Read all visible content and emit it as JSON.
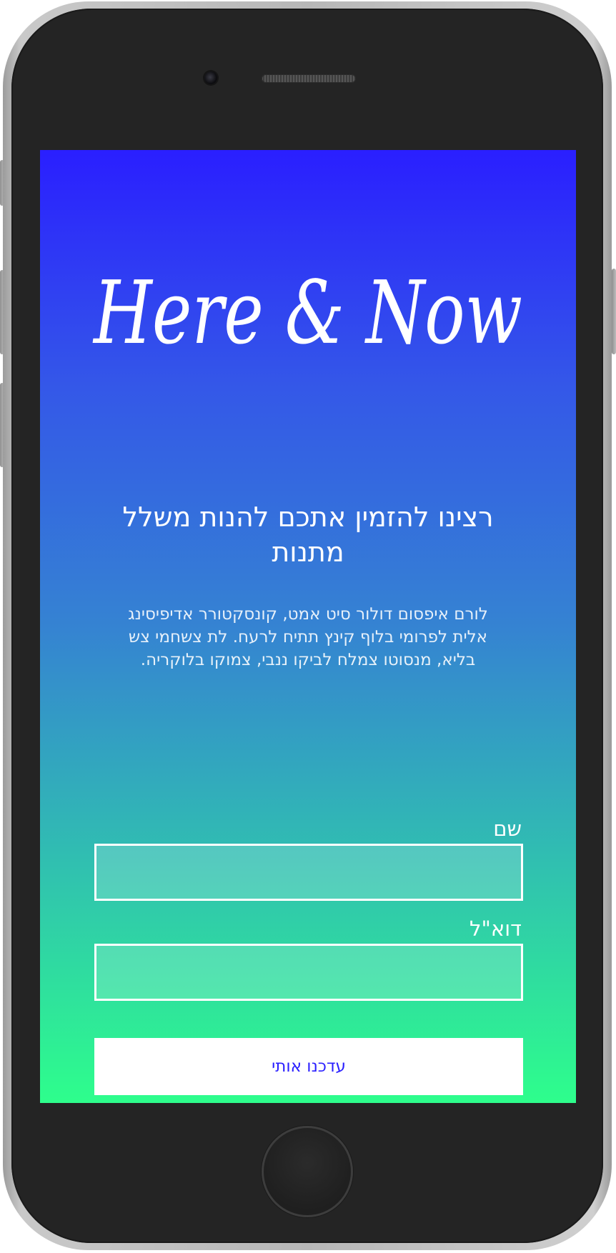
{
  "screen": {
    "background_top": "#2a1fff",
    "background_bottom": "#2efe8c"
  },
  "logo": {
    "text": "Here & Now"
  },
  "headline": {
    "text": "רצינו להזמין אתכם להנות משלל מתנות"
  },
  "body": {
    "text": "לורם איפסום דולור סיט אמט, קונסקטורר אדיפיסינג אלית לפרומי בלוף קינץ תתיח לרעח. לת צשחמי צש בליא, מנסוטו צמלח לביקו ננבי, צמוקו בלוקריה."
  },
  "form": {
    "name_label": "שם",
    "name_value": "",
    "email_label": "דוא\"ל",
    "email_value": "",
    "submit_label": "עדכנו אותי",
    "submit_color": "#2a1fff"
  },
  "device": {
    "frame_color": "#b7b7b7",
    "body_color": "#242424"
  }
}
